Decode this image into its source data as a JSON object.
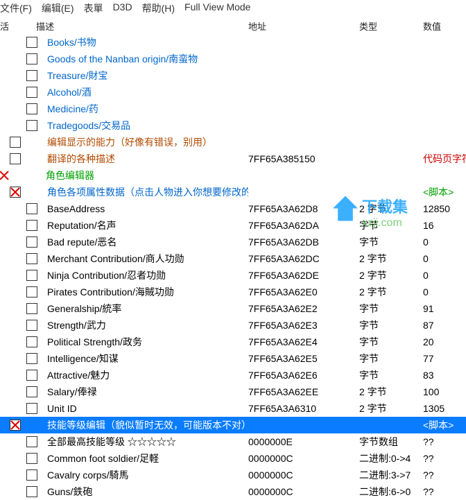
{
  "menu": {
    "file": "文件(F)",
    "edit": "编辑(E)",
    "table": "表單",
    "d3d": "D3D",
    "help": "帮助(H)",
    "fullview": "Full View Mode"
  },
  "headers": {
    "act": "活",
    "desc": "描述",
    "addr": "地址",
    "type": "类型",
    "val": "数值"
  },
  "rows": [
    {
      "indent": 0,
      "cbIndent": 38,
      "desc": "Books/书物",
      "cls": "blue-link",
      "addr": "",
      "type": "",
      "val": "",
      "x": false
    },
    {
      "indent": 0,
      "cbIndent": 38,
      "desc": "Goods of the Nanban origin/南蛮物",
      "cls": "blue-link",
      "addr": "",
      "type": "",
      "val": "",
      "x": false
    },
    {
      "indent": 0,
      "cbIndent": 38,
      "desc": "Treasure/財宝",
      "cls": "blue-link",
      "addr": "",
      "type": "",
      "val": "",
      "x": false
    },
    {
      "indent": 0,
      "cbIndent": 38,
      "desc": "Alcohol/酒",
      "cls": "blue-link",
      "addr": "",
      "type": "",
      "val": "",
      "x": false
    },
    {
      "indent": 0,
      "cbIndent": 38,
      "desc": "Medicine/药",
      "cls": "blue-link",
      "addr": "",
      "type": "",
      "val": "",
      "x": false
    },
    {
      "indent": 0,
      "cbIndent": 38,
      "desc": "Tradegoods/交易品",
      "cls": "blue-link",
      "addr": "",
      "type": "",
      "val": "",
      "x": false
    },
    {
      "indent": 0,
      "cbIndent": 14,
      "desc": "编辑显示的能力（好像有错误，别用）",
      "cls": "grp-text",
      "addr": "",
      "type": "",
      "val": "",
      "x": false
    },
    {
      "indent": 0,
      "cbIndent": 14,
      "desc": "翻译的各种描述",
      "cls": "grp-text",
      "addr": "7FF65A385150",
      "type": "",
      "val": "代码页字符串[???? ~ ???",
      "x": false,
      "valcls": "red"
    },
    {
      "indent": 0,
      "cbIndent": 0,
      "noCb": true,
      "desc": "角色编辑器",
      "cls": "green",
      "addr": "",
      "type": "",
      "val": "",
      "x": true
    },
    {
      "indent": 0,
      "cbIndent": 14,
      "desc": "角色各项属性数据（点击人物进入你想要修改的人物界面）",
      "cls": "blue-link",
      "addr": "",
      "type": "",
      "val": "<脚本>",
      "x": true,
      "valcls": "green"
    },
    {
      "indent": 0,
      "cbIndent": 38,
      "desc": "BaseAddress",
      "cls": "black",
      "addr": "7FF65A3A62D8",
      "type": "2 字节",
      "val": "12850",
      "x": false
    },
    {
      "indent": 0,
      "cbIndent": 38,
      "desc": "Reputation/名声",
      "cls": "black",
      "addr": "7FF65A3A62DA",
      "type": "字节",
      "val": "16",
      "x": false
    },
    {
      "indent": 0,
      "cbIndent": 38,
      "desc": "Bad repute/恶名",
      "cls": "black",
      "addr": "7FF65A3A62DB",
      "type": "字节",
      "val": "0",
      "x": false
    },
    {
      "indent": 0,
      "cbIndent": 38,
      "desc": "Merchant Contribution/商人功勋",
      "cls": "black",
      "addr": "7FF65A3A62DC",
      "type": "2 字节",
      "val": "0",
      "x": false
    },
    {
      "indent": 0,
      "cbIndent": 38,
      "desc": "Ninja Contribution/忍者功勋",
      "cls": "black",
      "addr": "7FF65A3A62DE",
      "type": "2 字节",
      "val": "0",
      "x": false
    },
    {
      "indent": 0,
      "cbIndent": 38,
      "desc": "Pirates Contribution/海賊功勋",
      "cls": "black",
      "addr": "7FF65A3A62E0",
      "type": "2 字节",
      "val": "0",
      "x": false
    },
    {
      "indent": 0,
      "cbIndent": 38,
      "desc": "Generalship/統率",
      "cls": "black",
      "addr": "7FF65A3A62E2",
      "type": "字节",
      "val": "91",
      "x": false
    },
    {
      "indent": 0,
      "cbIndent": 38,
      "desc": "Strength/武力",
      "cls": "black",
      "addr": "7FF65A3A62E3",
      "type": "字节",
      "val": "87",
      "x": false
    },
    {
      "indent": 0,
      "cbIndent": 38,
      "desc": "Political Strength/政务",
      "cls": "black",
      "addr": "7FF65A3A62E4",
      "type": "字节",
      "val": "20",
      "x": false
    },
    {
      "indent": 0,
      "cbIndent": 38,
      "desc": "Intelligence/知谋",
      "cls": "black",
      "addr": "7FF65A3A62E5",
      "type": "字节",
      "val": "77",
      "x": false
    },
    {
      "indent": 0,
      "cbIndent": 38,
      "desc": "Attractive/魅力",
      "cls": "black",
      "addr": "7FF65A3A62E6",
      "type": "字节",
      "val": "83",
      "x": false
    },
    {
      "indent": 0,
      "cbIndent": 38,
      "desc": "Salary/俸禄",
      "cls": "black",
      "addr": "7FF65A3A62EE",
      "type": "2 字节",
      "val": "100",
      "x": false
    },
    {
      "indent": 0,
      "cbIndent": 38,
      "desc": "Unit ID",
      "cls": "black",
      "addr": "7FF65A3A6310",
      "type": "2 字节",
      "val": "1305",
      "x": false
    },
    {
      "indent": 0,
      "cbIndent": 14,
      "desc": "技能等级编辑（貌似暂时无效，可能版本不对）",
      "cls": "black",
      "addr": "",
      "type": "",
      "val": "<脚本>",
      "x": true,
      "hl": true
    },
    {
      "indent": 0,
      "cbIndent": 38,
      "desc": "全部最高技能等级 ☆☆☆☆☆",
      "cls": "black",
      "addr": "0000000E",
      "type": "字节数组",
      "val": "??",
      "x": false
    },
    {
      "indent": 0,
      "cbIndent": 38,
      "desc": "Common foot soldier/足軽",
      "cls": "black",
      "addr": "0000000C",
      "type": "二进制:0->4",
      "val": "??",
      "x": false
    },
    {
      "indent": 0,
      "cbIndent": 38,
      "desc": "Cavalry corps/騎馬",
      "cls": "black",
      "addr": "0000000C",
      "type": "二进制:3->7",
      "val": "??",
      "x": false
    },
    {
      "indent": 0,
      "cbIndent": 38,
      "desc": "Guns/鉄砲",
      "cls": "black",
      "addr": "0000000C",
      "type": "二进制:6->0",
      "val": "??",
      "x": false
    }
  ],
  "watermark": {
    "text1": "下载集",
    "text2": "xzji.com"
  }
}
